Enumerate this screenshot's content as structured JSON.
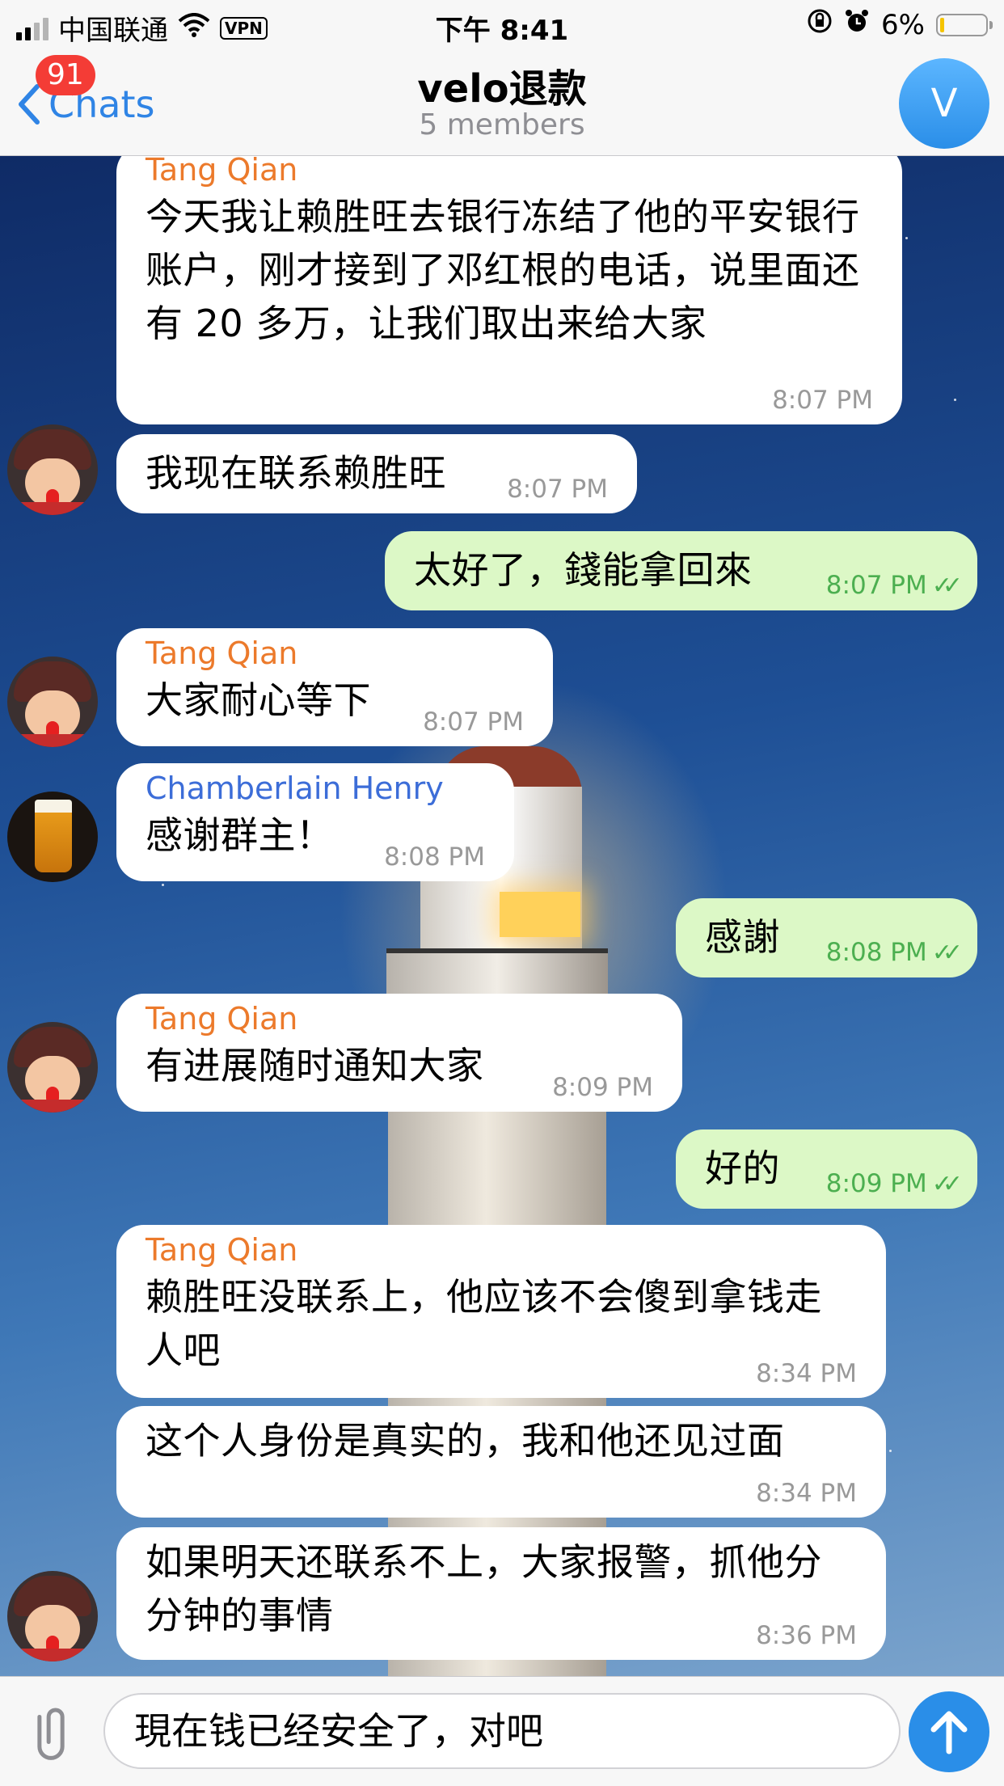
{
  "status_bar": {
    "carrier": "中国联通",
    "vpn": "VPN",
    "time": "下午 8:41",
    "battery": "6%",
    "battery_level": 0.06
  },
  "nav": {
    "back_label": "Chats",
    "unread_badge": "91",
    "title": "velo退款",
    "subtitle": "5 members",
    "avatar_letter": "V"
  },
  "messages": [
    {
      "sender": "Tang Qian",
      "text": "今天我让赖胜旺去银行冻结了他的平安银行账户，刚才接到了邓红根的电话，说里面还有 20 多万，让我们取出来给大家",
      "time": "8:07 PM"
    },
    {
      "text": "我现在联系赖胜旺",
      "time": "8:07 PM"
    },
    {
      "text": "太好了，錢能拿回來",
      "time": "8:07 PM",
      "read_mark": "✓✓"
    },
    {
      "sender": "Tang Qian",
      "text": "大家耐心等下",
      "time": "8:07 PM"
    },
    {
      "sender": "Chamberlain Henry",
      "text": "感谢群主！",
      "time": "8:08 PM"
    },
    {
      "text": "感謝",
      "time": "8:08 PM",
      "read_mark": "✓✓"
    },
    {
      "sender": "Tang Qian",
      "text": "有进展随时通知大家",
      "time": "8:09 PM"
    },
    {
      "text": "好的",
      "time": "8:09 PM",
      "read_mark": "✓✓"
    },
    {
      "sender": "Tang Qian",
      "text": "赖胜旺没联系上，他应该不会傻到拿钱走人吧",
      "time": "8:34 PM"
    },
    {
      "text": "这个人身份是真实的，我和他还见过面",
      "time": "8:34 PM"
    },
    {
      "text": "如果明天还联系不上，大家报警，抓他分分钟的事情",
      "time": "8:36 PM"
    }
  ],
  "input": {
    "value": "現在钱已经安全了，对吧"
  },
  "icons": {
    "attach": "paperclip-icon",
    "send": "send-arrow-icon",
    "back": "chevron-left-icon",
    "wifi": "wifi-icon",
    "alarm": "alarm-icon",
    "rotation_lock": "rotation-lock-icon"
  },
  "colors": {
    "accent": "#2a8ee8",
    "outgoing_bubble": "#dcf8c6",
    "sender_orange": "#ec7a2b",
    "sender_blue": "#3c6dd8",
    "badge_red": "#f43c36"
  }
}
